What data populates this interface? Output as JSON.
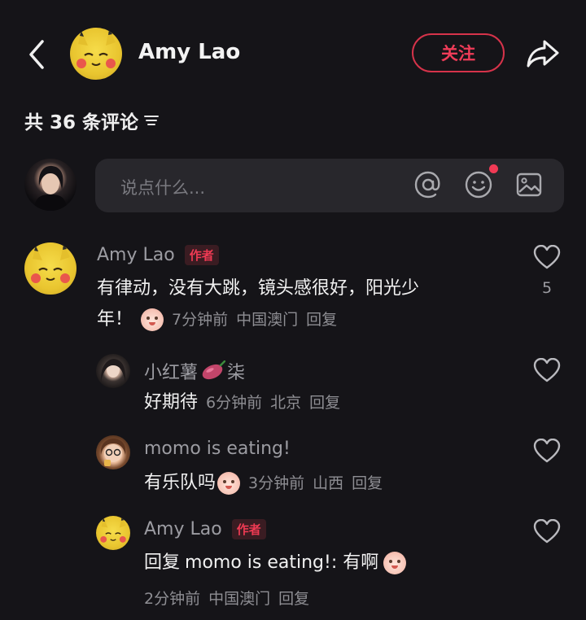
{
  "header": {
    "name": "Amy Lao",
    "follow_label": "关注"
  },
  "comments_header": {
    "count_text": "共 36 条评论"
  },
  "input": {
    "placeholder": "说点什么..."
  },
  "comments": [
    {
      "author": "Amy Lao",
      "tag": "作者",
      "text_line1": "有律动，没有大跳，镜头感很好，阳光少",
      "text_line2": "年！",
      "time": "7分钟前",
      "location": "中国澳门",
      "reply_label": "回复",
      "likes": "5",
      "replies": [
        {
          "author": "小红薯",
          "author_suffix": "柒",
          "text": "好期待",
          "time": "6分钟前",
          "location": "北京",
          "reply_label": "回复"
        },
        {
          "author": "momo is eating!",
          "text": "有乐队吗",
          "time": "3分钟前",
          "location": "山西",
          "reply_label": "回复"
        },
        {
          "author": "Amy Lao",
          "tag": "作者",
          "reply_prefix": "回复",
          "reply_to": "momo is eating!",
          "text": ": 有啊",
          "time": "2分钟前",
          "location": "中国澳门",
          "reply_label": "回复"
        }
      ]
    }
  ],
  "icons": {
    "back": "chevron-left-icon",
    "share": "share-arrow-icon",
    "filter": "filter-lines-icon",
    "at": "at-sign-icon",
    "emoji": "smiley-icon",
    "image": "image-icon",
    "like": "heart-outline-icon"
  },
  "colors": {
    "background": "#151418",
    "accent_red": "#ef3c58",
    "input_bg": "#28272c"
  }
}
